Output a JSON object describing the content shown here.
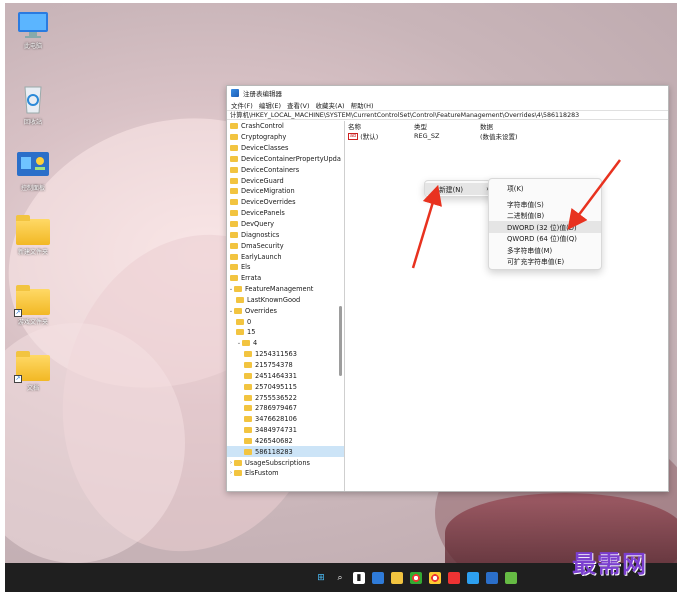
{
  "desktop": {
    "icons": [
      {
        "label": "此电脑"
      },
      {
        "label": "回收站"
      },
      {
        "label": "控制面板"
      },
      {
        "label": "新建文件夹"
      },
      {
        "label": "游戏文件夹"
      },
      {
        "label": "文档"
      }
    ]
  },
  "regedit": {
    "title": "注册表编辑器",
    "menu": [
      "文件(F)",
      "编辑(E)",
      "查看(V)",
      "收藏夹(A)",
      "帮助(H)"
    ],
    "address": "计算机\\HKEY_LOCAL_MACHINE\\SYSTEM\\CurrentControlSet\\Control\\FeatureManagement\\Overrides\\4\\586118283",
    "tree": [
      {
        "label": "CrashControl"
      },
      {
        "label": "Cryptography"
      },
      {
        "label": "DeviceClasses"
      },
      {
        "label": "DeviceContainerPropertyUpda"
      },
      {
        "label": "DeviceContainers"
      },
      {
        "label": "DeviceGuard"
      },
      {
        "label": "DeviceMigration"
      },
      {
        "label": "DeviceOverrides"
      },
      {
        "label": "DevicePanels"
      },
      {
        "label": "DevQuery"
      },
      {
        "label": "Diagnostics"
      },
      {
        "label": "DmaSecurity"
      },
      {
        "label": "EarlyLaunch"
      },
      {
        "label": "Els"
      },
      {
        "label": "Errata"
      },
      {
        "label": "FeatureManagement",
        "twisty": "v"
      },
      {
        "label": "LastKnownGood"
      },
      {
        "label": "Overrides",
        "twisty": "v"
      },
      {
        "label": "0"
      },
      {
        "label": "15"
      },
      {
        "label": "4",
        "twisty": "v"
      },
      {
        "label": "1254311563"
      },
      {
        "label": "215754378"
      },
      {
        "label": "2451464331"
      },
      {
        "label": "2570495115"
      },
      {
        "label": "2755536522"
      },
      {
        "label": "2786979467"
      },
      {
        "label": "3476628106"
      },
      {
        "label": "3484974731"
      },
      {
        "label": "426540682"
      },
      {
        "label": "586118283",
        "selected": true
      },
      {
        "label": "UsageSubscriptions",
        "twisty": ">"
      },
      {
        "label": "ElsFustom",
        "twisty": ">"
      }
    ],
    "columns": {
      "name": "名称",
      "type": "类型",
      "data": "数据"
    },
    "values": [
      {
        "name": "(默认)",
        "type": "REG_SZ",
        "data": "(数值未设置)",
        "icon": "ab"
      }
    ]
  },
  "context_menu": {
    "new_label": "新建(N)",
    "submenu_arrow": "›"
  },
  "submenu": {
    "items": [
      {
        "label": "项(K)"
      },
      {
        "label": "字符串值(S)"
      },
      {
        "label": "二进制值(B)"
      },
      {
        "label": "DWORD (32 位)值(D)",
        "highlighted": true
      },
      {
        "label": "QWORD (64 位)值(Q)"
      },
      {
        "label": "多字符串值(M)"
      },
      {
        "label": "可扩充字符串值(E)"
      }
    ]
  },
  "annotation_color": "#e8321f",
  "watermark": "最需网"
}
